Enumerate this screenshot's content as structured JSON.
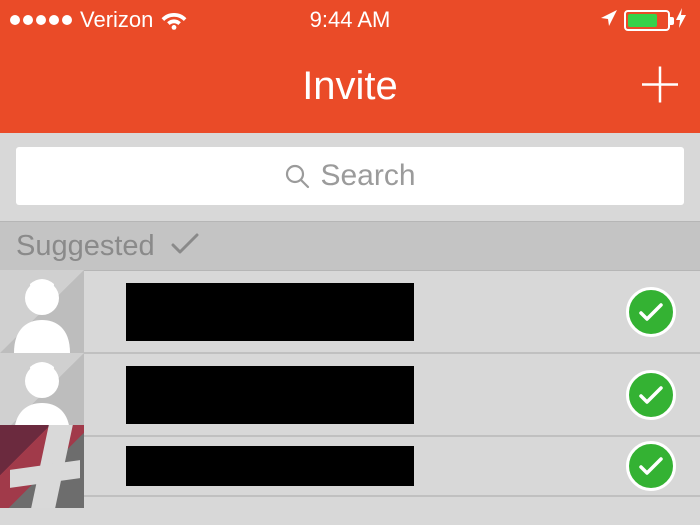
{
  "status": {
    "carrier": "Verizon",
    "time": "9:44 AM"
  },
  "nav": {
    "title": "Invite"
  },
  "search": {
    "placeholder": "Search"
  },
  "section": {
    "label": "Suggested"
  },
  "colors": {
    "accent": "#ea4b28",
    "confirm": "#34b233"
  },
  "contacts": [
    {
      "name_redacted": true,
      "selected": true,
      "avatar": "default"
    },
    {
      "name_redacted": true,
      "selected": true,
      "avatar": "default"
    },
    {
      "name_redacted": true,
      "selected": true,
      "avatar": "photo"
    }
  ]
}
